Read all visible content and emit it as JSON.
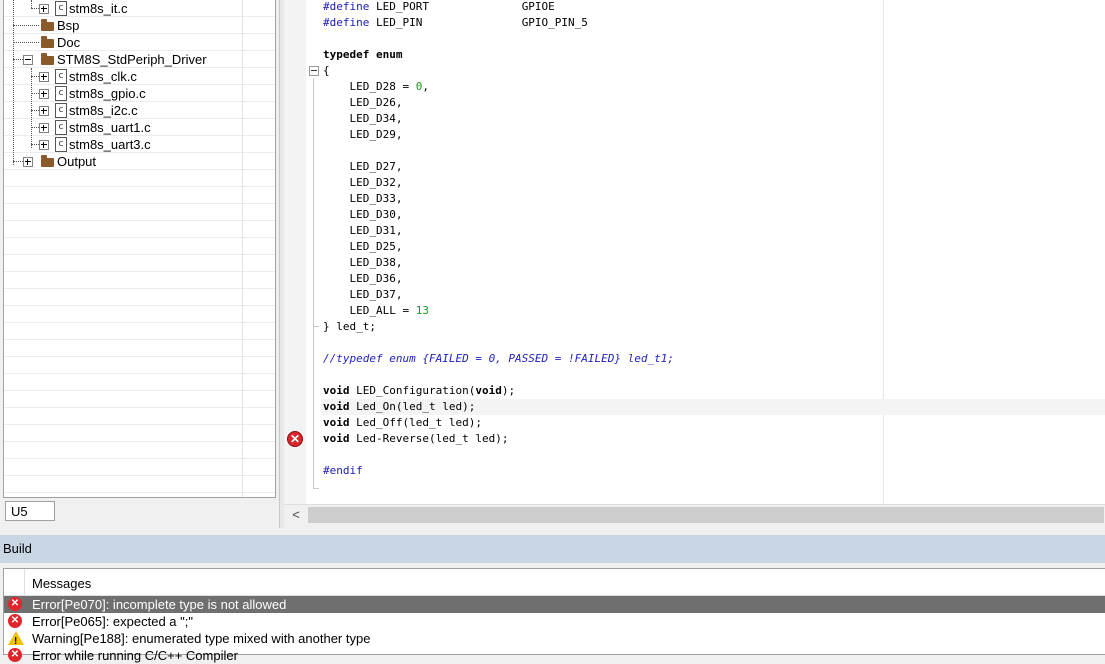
{
  "workspace": {
    "tree": [
      {
        "label": "stm8s_it.c",
        "type": "file"
      },
      {
        "label": "Bsp",
        "type": "folder"
      },
      {
        "label": "Doc",
        "type": "folder"
      },
      {
        "label": "STM8S_StdPeriph_Driver",
        "type": "folder"
      },
      {
        "label": "stm8s_clk.c",
        "type": "file"
      },
      {
        "label": "stm8s_gpio.c",
        "type": "file"
      },
      {
        "label": "stm8s_i2c.c",
        "type": "file"
      },
      {
        "label": "stm8s_uart1.c",
        "type": "file"
      },
      {
        "label": "stm8s_uart3.c",
        "type": "file"
      },
      {
        "label": "Output",
        "type": "folder"
      }
    ],
    "tab_label": "U5"
  },
  "editor": {
    "lines": [
      {
        "pre": "#define",
        "a": " LED_PORT              ",
        "b": "GPIOE"
      },
      {
        "pre": "#define",
        "a": " LED_PIN               ",
        "b": "GPIO_PIN_5"
      },
      {
        "text": ""
      },
      {
        "kw": "typedef enum",
        "text": ""
      },
      {
        "text": "{"
      },
      {
        "text": "    LED_D28 = ",
        "num": "0",
        "tail": ","
      },
      {
        "text": "    LED_D26,"
      },
      {
        "text": "    LED_D34,"
      },
      {
        "text": "    LED_D29,"
      },
      {
        "text": ""
      },
      {
        "text": "    LED_D27,"
      },
      {
        "text": "    LED_D32,"
      },
      {
        "text": "    LED_D33,"
      },
      {
        "text": "    LED_D30,"
      },
      {
        "text": "    LED_D31,"
      },
      {
        "text": "    LED_D25,"
      },
      {
        "text": "    LED_D38,"
      },
      {
        "text": "    LED_D36,"
      },
      {
        "text": "    LED_D37,"
      },
      {
        "text": "    LED_ALL = ",
        "num": "13",
        "tail": ""
      },
      {
        "text": "} led_t;"
      },
      {
        "text": ""
      },
      {
        "comment": "//typedef enum {FAILED = 0, PASSED = !FAILED} led_t1;"
      },
      {
        "text": ""
      },
      {
        "kw": "void",
        "text": " LED_Configuration(",
        "kw2": "void",
        "tail": ");"
      },
      {
        "kw": "void",
        "text": " Led_On(led_t led);"
      },
      {
        "kw": "void",
        "text": " Led_Off(led_t led);"
      },
      {
        "kw": "void",
        "text": " Led-Reverse(led_t led);"
      },
      {
        "text": ""
      },
      {
        "pre": "#endif",
        "a": "",
        "b": ""
      }
    ]
  },
  "build": {
    "title": "Build",
    "column_header": "Messages",
    "messages": [
      {
        "level": "error",
        "text": "Error[Pe070]: incomplete type is not allowed",
        "selected": true
      },
      {
        "level": "error",
        "text": "Error[Pe065]: expected a \";\"",
        "selected": false
      },
      {
        "level": "warning",
        "text": "Warning[Pe188]: enumerated type mixed with another type",
        "selected": false
      },
      {
        "level": "error",
        "text": "Error while running C/C++ Compiler",
        "selected": false
      }
    ]
  },
  "icons": {
    "error": "error-icon",
    "warning": "warning-icon",
    "scroll_left": "chevron-left-icon"
  },
  "colors": {
    "preprocessor": "#1a1ab4",
    "number": "#1c9a1c",
    "comment": "#2222c0",
    "build_header": "#c9d6e4",
    "selected_row": "#6f6f6f",
    "error_red": "#e0262c",
    "warning_yellow": "#f2c200"
  }
}
